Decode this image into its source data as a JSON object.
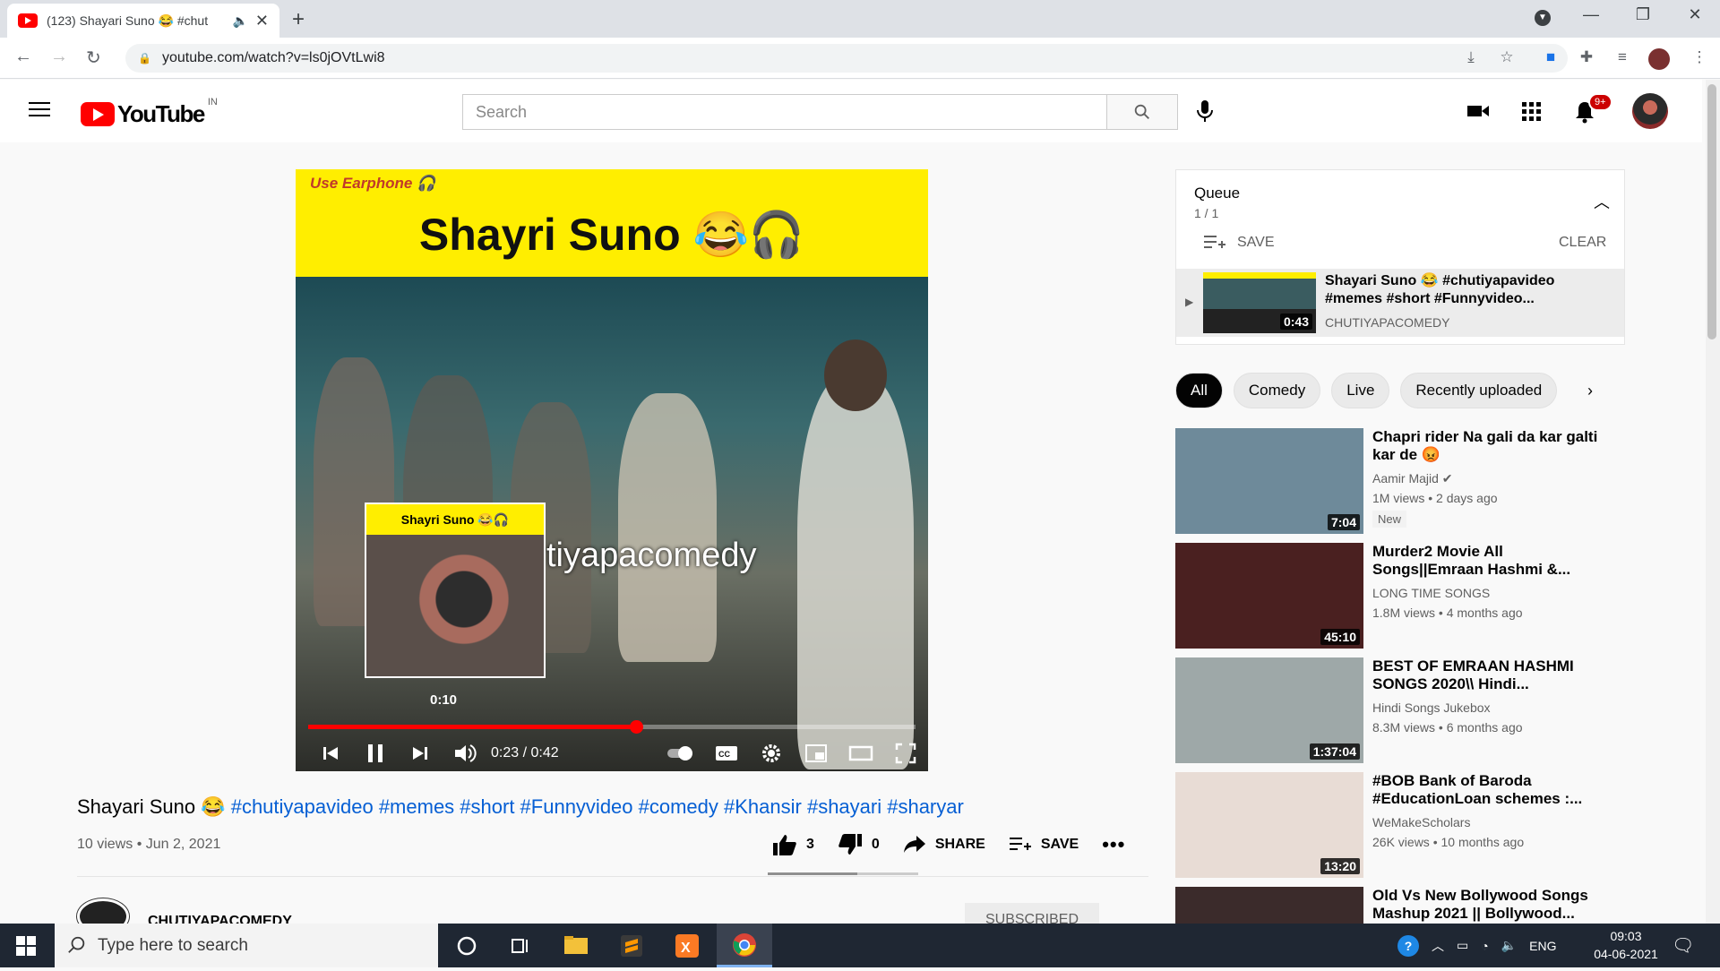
{
  "browser": {
    "tab_title": "(123) Shayari Suno 😂 #chut",
    "url": "youtube.com/watch?v=ls0jOVtLwi8"
  },
  "youtube": {
    "logo_text": "YouTube",
    "country": "IN",
    "search_placeholder": "Search",
    "notif_count": "9+"
  },
  "player": {
    "video_top_text": "Use Earphone 🎧",
    "video_title_text": "Shayri Suno 😂🎧",
    "watermark": "tiyapacomedy",
    "preview_title": "Shayri Suno 😂🎧",
    "preview_time": "0:10",
    "time": "0:23 / 0:42",
    "progress_fraction": 0.54
  },
  "video": {
    "title": "Shayari Suno 😂 ",
    "hashtags": "#chutiyapavideo #memes #short #Funnyvideo #comedy #Khansir #shayari #sharyar",
    "meta": "10 views • Jun 2, 2021",
    "likes": "3",
    "dislikes": "0",
    "share": "SHARE",
    "save": "SAVE",
    "channel": "CHUTIYAPACOMEDY",
    "subscribe": "SUBSCRIBED"
  },
  "queue": {
    "title": "Queue",
    "count": "1 / 1",
    "save": "SAVE",
    "clear": "CLEAR",
    "item": {
      "title": "Shayari Suno 😂 #chutiyapavideo #memes #short #Funnyvideo...",
      "channel": "CHUTIYAPACOMEDY",
      "duration": "0:43"
    }
  },
  "chips": [
    "All",
    "Comedy",
    "Live",
    "Recently uploaded"
  ],
  "recommendations": [
    {
      "title": "Chapri rider Na gali da kar galti kar de 😡",
      "channel": "Aamir Majid ✔",
      "meta": "1M views • 2 days ago",
      "badge": "New",
      "duration": "7:04",
      "color": "#6e8a9a"
    },
    {
      "title": "Murder2 Movie All Songs||Emraan Hashmi &...",
      "channel": "LONG TIME SONGS",
      "meta": "1.8M views • 4 months ago",
      "badge": "",
      "duration": "45:10",
      "color": "#4a2020"
    },
    {
      "title": "BEST OF EMRAAN HASHMI SONGS 2020\\\\ Hindi...",
      "channel": "Hindi Songs Jukebox",
      "meta": "8.3M views • 6 months ago",
      "badge": "",
      "duration": "1:37:04",
      "color": "#9ea8a8"
    },
    {
      "title": "#BOB Bank of Baroda #EducationLoan schemes :...",
      "channel": "WeMakeScholars",
      "meta": "26K views • 10 months ago",
      "badge": "",
      "duration": "13:20",
      "color": "#e8dcd5"
    },
    {
      "title": "Old Vs New Bollywood Songs Mashup 2021 || Bollywood...",
      "channel": "",
      "meta": "",
      "badge": "",
      "duration": "",
      "color": "#3b2b2b"
    }
  ],
  "taskbar": {
    "search_placeholder": "Type here to search",
    "lang": "ENG",
    "time": "09:03",
    "date": "04-06-2021"
  }
}
